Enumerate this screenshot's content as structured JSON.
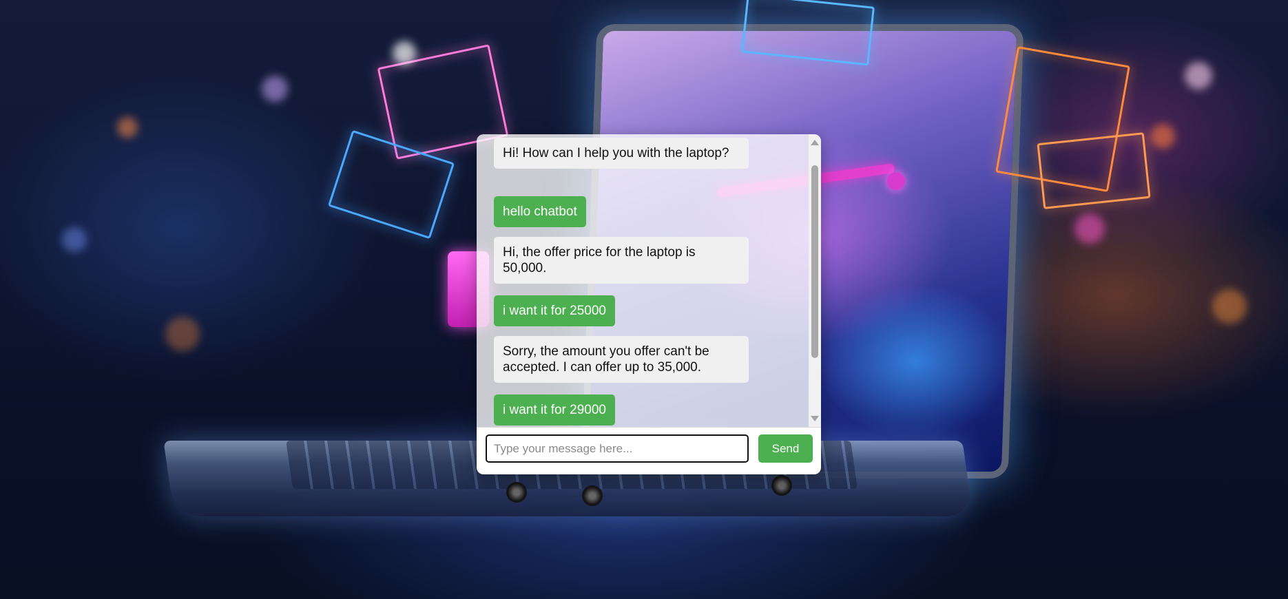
{
  "chat": {
    "messages": [
      {
        "sender": "bot",
        "text": "Hi! How can I help you with the laptop?"
      },
      {
        "sender": "user",
        "text": "hello chatbot"
      },
      {
        "sender": "bot",
        "text": "Hi, the offer price for the laptop is 50,000."
      },
      {
        "sender": "user",
        "text": "i want it for 25000"
      },
      {
        "sender": "bot",
        "text": "Sorry, the amount you offer can't be accepted. I can offer up to 35,000."
      },
      {
        "sender": "user",
        "text": "i want it for 29000"
      }
    ],
    "input": {
      "value": "",
      "placeholder": "Type your message here..."
    },
    "send_label": "Send"
  },
  "colors": {
    "user_bubble": "#4caf50",
    "bot_bubble": "#f0f0f0",
    "send_button": "#4caf50"
  },
  "icons": {
    "scroll_up": "scroll-up-arrow-icon",
    "scroll_down": "scroll-down-arrow-icon"
  }
}
